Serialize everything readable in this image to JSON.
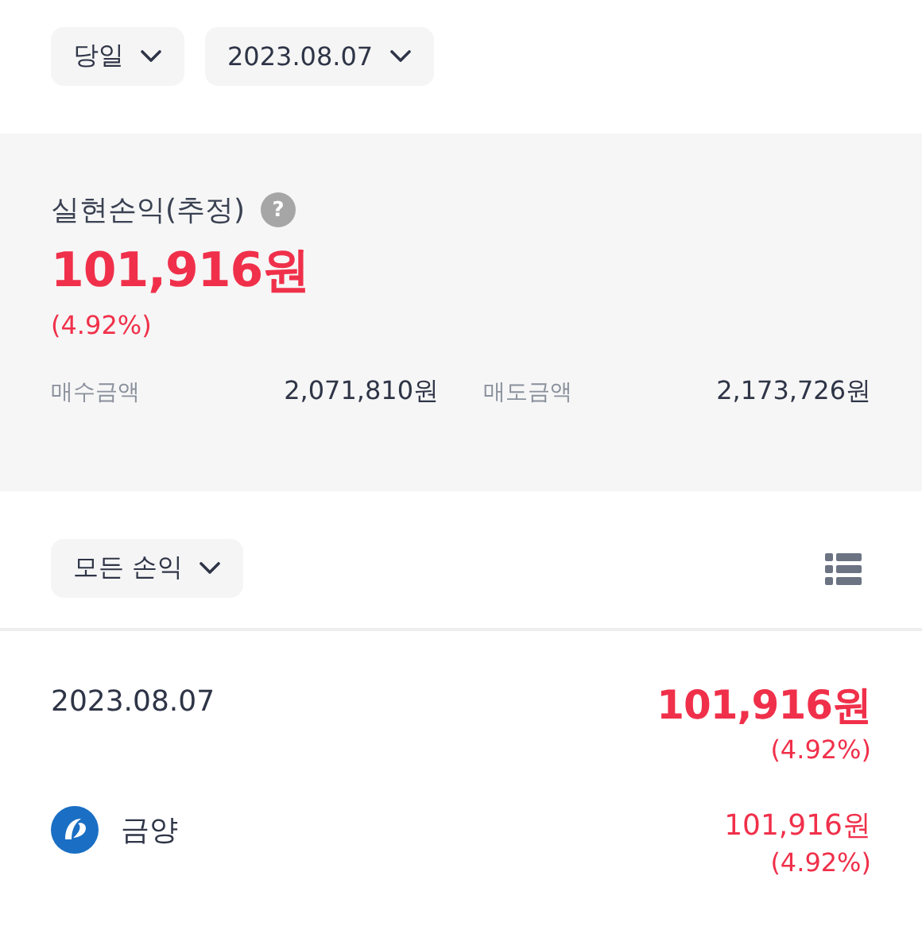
{
  "filters": [
    {
      "label": "당일"
    },
    {
      "label": "2023.08.07"
    }
  ],
  "summary": {
    "title": "실현손익(추정)",
    "help": "?",
    "amount": "101,916원",
    "rate": "(4.92%)",
    "gain": true,
    "stats": [
      {
        "label": "매수금액",
        "value": "2,071,810원"
      },
      {
        "label": "매도금액",
        "value": "2,173,726원"
      }
    ]
  },
  "list_filter": {
    "label": "모든 손익"
  },
  "days": [
    {
      "date": "2023.08.07",
      "amount": "101,916원",
      "rate": "(4.92%)",
      "gain": true,
      "stocks": [
        {
          "name": "금양",
          "amount": "101,916원",
          "rate": "(4.92%)",
          "gain": true
        }
      ]
    }
  ]
}
